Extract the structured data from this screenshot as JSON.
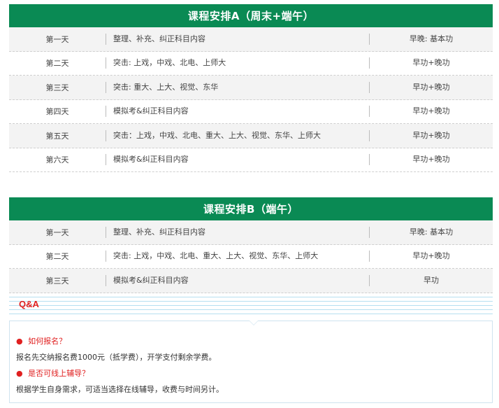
{
  "schedule_a": {
    "title": "课程安排A（周末+端午）",
    "rows": [
      {
        "day": "第一天",
        "content": "整理、补充、纠正科目内容",
        "time": "早晚: 基本功"
      },
      {
        "day": "第二天",
        "content": "突击: 上戏，中戏、北电、上师大",
        "time": "早功+晚功"
      },
      {
        "day": "第三天",
        "content": "突击: 重大、上大、视觉、东华",
        "time": "早功+晚功"
      },
      {
        "day": "第四天",
        "content": "模拟考&纠正科目内容",
        "time": "早功+晚功"
      },
      {
        "day": "第五天",
        "content": "突击：上戏，中戏、北电、重大、上大、视觉、东华、上师大",
        "time": "早功+晚功"
      },
      {
        "day": "第六天",
        "content": "模拟考&纠正科目内容",
        "time": "早功+晚功"
      }
    ]
  },
  "schedule_b": {
    "title": "课程安排B（端午）",
    "rows": [
      {
        "day": "第一天",
        "content": "整理、补充、纠正科目内容",
        "time": "早晚: 基本功"
      },
      {
        "day": "第二天",
        "content": "突击: 上戏，中戏、北电、重大、上大、视觉、东华、上师大",
        "time": "早功+晚功"
      },
      {
        "day": "第三天",
        "content": "模拟考&纠正科目内容",
        "time": "早功"
      }
    ]
  },
  "qa": {
    "title": "Q&A",
    "items": [
      {
        "bullet": "●",
        "question": "如何报名？",
        "answer": "报名先交纳报名费1000元（抵学费），开学支付剩余学费。"
      },
      {
        "bullet": "●",
        "question": "是否可线上辅导？",
        "answer": "根据学生自身需求，可适当选择在线辅导，收费与时间另计。"
      }
    ]
  },
  "colors": {
    "header_green": "#0a8a54",
    "qa_red": "#e02020",
    "qa_line_blue": "#b6dff0"
  }
}
